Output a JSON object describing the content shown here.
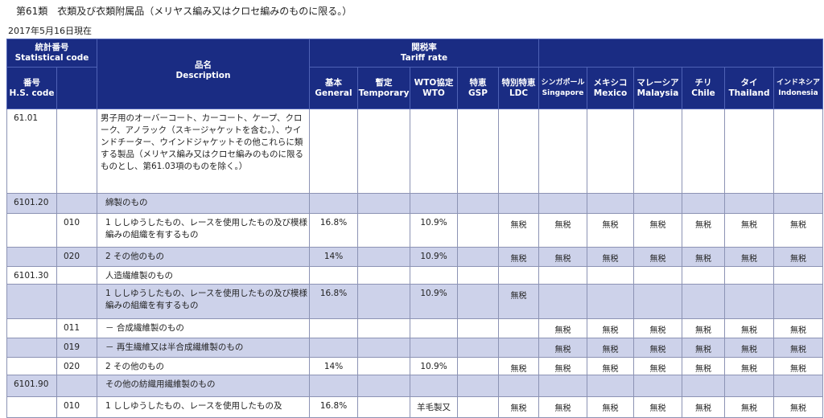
{
  "title": "第61類　衣類及び衣類附属品（メリヤス編み又はクロセ編みのものに限る。）",
  "date": "2017年5月16日現在",
  "header": {
    "stat_code_jp": "統計番号",
    "stat_code_en": "Statistical code",
    "hs_jp": "番号",
    "hs_en": "H.S. code",
    "desc_jp": "品名",
    "desc_en": "Description",
    "tariff_jp": "関税率",
    "tariff_en": "Tariff rate",
    "columns": [
      {
        "jp": "基本",
        "en": "General"
      },
      {
        "jp": "暫定",
        "en": "Temporary"
      },
      {
        "jp": "WTO協定",
        "en": "WTO"
      },
      {
        "jp": "特恵",
        "en": "GSP"
      },
      {
        "jp": "特別特恵",
        "en": "LDC"
      },
      {
        "jp": "シンガポール",
        "en": "Singapore"
      },
      {
        "jp": "メキシコ",
        "en": "Mexico"
      },
      {
        "jp": "マレーシア",
        "en": "Malaysia"
      },
      {
        "jp": "チリ",
        "en": "Chile"
      },
      {
        "jp": "タイ",
        "en": "Thailand"
      },
      {
        "jp": "インドネシア",
        "en": "Indonesia"
      }
    ]
  },
  "rows": [
    {
      "hs": "61.01",
      "stat": "",
      "desc": "男子用のオーバーコート、カーコート、ケープ、クローク、アノラック（スキージャケットを含む。）、ウインドチーター、ウインドジャケットその他これらに類する製品（メリヤス編み又はクロセ編みのものに限るものとし、第61.03項のものを除く。）",
      "rates": [
        "",
        "",
        "",
        "",
        "",
        "",
        "",
        "",
        "",
        "",
        ""
      ]
    },
    {
      "hs": "6101.20",
      "stat": "",
      "desc": "綿製のもの",
      "rates": [
        "",
        "",
        "",
        "",
        "",
        "",
        "",
        "",
        "",
        "",
        ""
      ]
    },
    {
      "hs": "",
      "stat": "010",
      "desc": "1 ししゆうしたもの、レースを使用したもの及び模様編みの組織を有するもの",
      "rates": [
        "16.8%",
        "",
        "10.9%",
        "",
        "無税",
        "無税",
        "無税",
        "無税",
        "無税",
        "無税",
        "無税"
      ]
    },
    {
      "hs": "",
      "stat": "020",
      "desc": "2 その他のもの",
      "rates": [
        "14%",
        "",
        "10.9%",
        "",
        "無税",
        "無税",
        "無税",
        "無税",
        "無税",
        "無税",
        "無税"
      ]
    },
    {
      "hs": "6101.30",
      "stat": "",
      "desc": "人造繊維製のもの",
      "rates": [
        "",
        "",
        "",
        "",
        "",
        "",
        "",
        "",
        "",
        "",
        ""
      ]
    },
    {
      "hs": "",
      "stat": "",
      "desc": "1 ししゆうしたもの、レースを使用したもの及び模様編みの組織を有するもの",
      "rates": [
        "16.8%",
        "",
        "10.9%",
        "",
        "無税",
        "",
        "",
        "",
        "",
        "",
        ""
      ]
    },
    {
      "hs": "",
      "stat": "011",
      "desc": "－ 合成繊維製のもの",
      "rates": [
        "",
        "",
        "",
        "",
        "",
        "無税",
        "無税",
        "無税",
        "無税",
        "無税",
        "無税"
      ]
    },
    {
      "hs": "",
      "stat": "019",
      "desc": "－ 再生繊維又は半合成繊維製のもの",
      "rates": [
        "",
        "",
        "",
        "",
        "",
        "無税",
        "無税",
        "無税",
        "無税",
        "無税",
        "無税"
      ]
    },
    {
      "hs": "",
      "stat": "020",
      "desc": "2 その他のもの",
      "rates": [
        "14%",
        "",
        "10.9%",
        "",
        "無税",
        "無税",
        "無税",
        "無税",
        "無税",
        "無税",
        "無税"
      ]
    },
    {
      "hs": "6101.90",
      "stat": "",
      "desc": "その他の紡織用繊維製のもの",
      "rates": [
        "",
        "",
        "",
        "",
        "",
        "",
        "",
        "",
        "",
        "",
        ""
      ]
    },
    {
      "hs": "",
      "stat": "010",
      "desc": "1 ししゆうしたもの、レースを使用したもの及",
      "rates": [
        "16.8%",
        "",
        "羊毛製又",
        "",
        "無税",
        "無税",
        "無税",
        "無税",
        "無税",
        "無税",
        "無税"
      ]
    }
  ]
}
